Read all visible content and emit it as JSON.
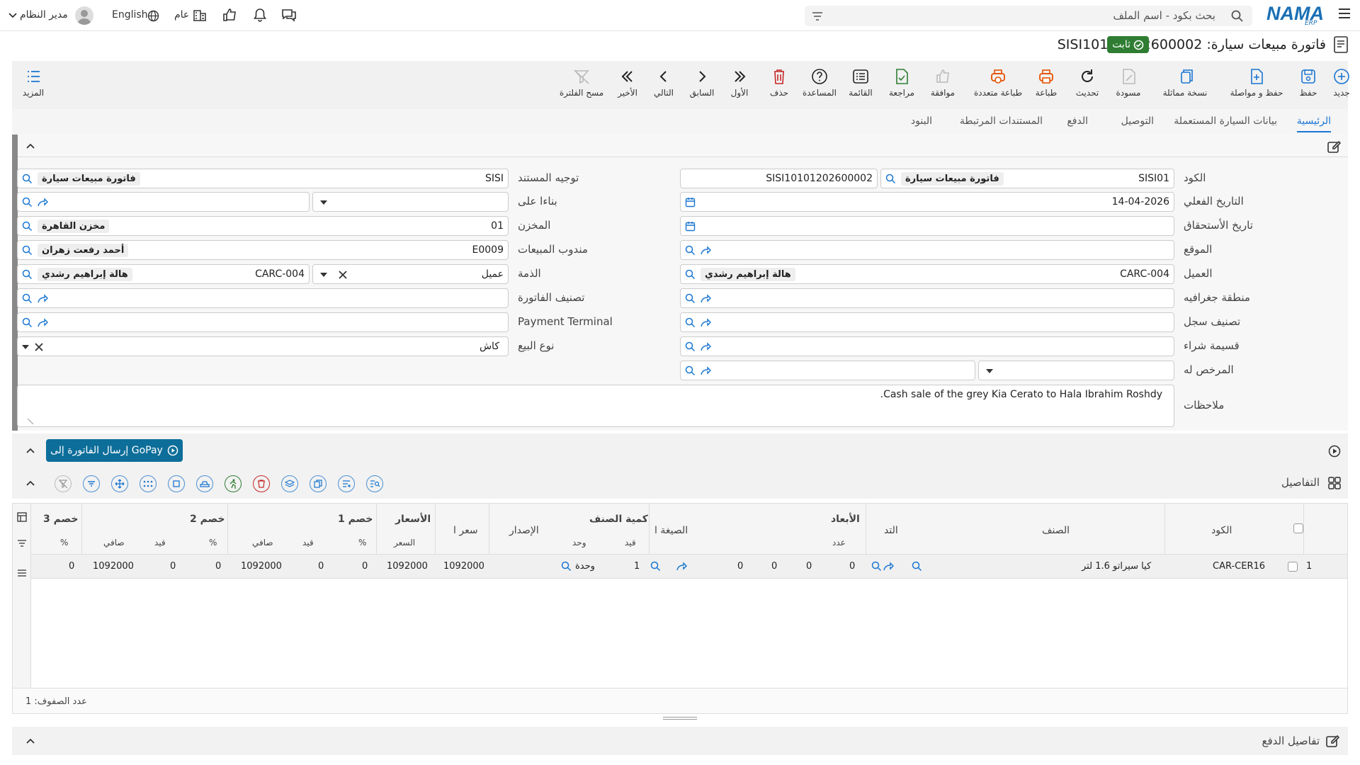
{
  "topbar": {
    "logo": "NAMA",
    "logo_sub": "ERP",
    "search_placeholder": "بحث بكود - اسم الملف",
    "user": "مدير النظام",
    "language": "English",
    "scope": "عام"
  },
  "title": {
    "text": "فاتورة مبيعات سيارة: SISI10101202600002",
    "status": "ثابت"
  },
  "toolbar": {
    "new": "جديد",
    "save": "حفظ",
    "save_continue": "حفظ و مواصلة",
    "duplicate": "نسخة مماثلة",
    "draft": "مسودة",
    "refresh": "تحديث",
    "print": "طباعة",
    "multi_print": "طباعة متعددة",
    "approve": "موافقة",
    "review": "مراجعة",
    "list": "القائمة",
    "help": "المساعدة",
    "delete": "حذف",
    "first": "الأول",
    "previous": "السابق",
    "next": "التالي",
    "last": "الأخير",
    "clear_filter": "مسح الفلترة",
    "more": "المزيد"
  },
  "tabs": [
    "الرئيسية",
    "بيانات السيارة المستعملة",
    "التوصيل",
    "الدفع",
    "المستندات المرتبطة",
    "البنود"
  ],
  "form": {
    "code_label": "الكود",
    "code_value": "SISI01",
    "code_chip": "فاتورة مبيعات سيارة",
    "code_serial": "SISI10101202600002",
    "actual_date_label": "التاريخ الفعلي",
    "actual_date": "14-04-2026",
    "due_date_label": "تاريخ الأستحقاق",
    "site_label": "الموقع",
    "customer_label": "العميل",
    "customer_code": "CARC-004",
    "customer_name": "هالة إبراهيم رشدي",
    "region_label": "منطقة جغرافيه",
    "record_class_label": "تصنيف سجل",
    "purchase_voucher_label": "قسيمة شراء",
    "licensee_label": "المرخص له",
    "notes_label": "ملاحظات",
    "notes": "Cash sale of the grey Kia Cerato to Hala Ibrahim Roshdy.",
    "doc_direction_label": "توجيه المستند",
    "doc_direction_value": "SISI",
    "doc_direction_chip": "فاتورة مبيعات سيارة",
    "based_on_label": "بناءا على",
    "warehouse_label": "المخزن",
    "warehouse_code": "01",
    "warehouse_name": "مخزن القاهرة",
    "salesman_label": "مندوب المبيعات",
    "salesman_code": "E0009",
    "salesman_name": "أحمد رفعت زهران",
    "liability_label": "الذمة",
    "liability_type": "عميل",
    "liability_code": "CARC-004",
    "liability_name": "هالة إبراهيم رشدي",
    "invoice_class_label": "تصنيف الفاتورة",
    "payment_terminal_label": "Payment Terminal",
    "sale_type_label": "نوع البيع",
    "sale_type": "كاش"
  },
  "gopay": "إرسال الفاتورة إلى GoPay",
  "details": {
    "title": "التفاصيل",
    "group_headers": [
      "الأبعاد",
      "كمية الصنف",
      "الأسعار",
      "خصم 1",
      "خصم 2",
      "خصم 3"
    ],
    "columns": [
      "الكود",
      "الصنف",
      "التد",
      "عدد",
      "الصيغة ا",
      "قيد",
      "وحد",
      "الإصدار",
      "سعر ا",
      "السعر",
      "%",
      "قيد",
      "صافي",
      "%",
      "قيد",
      "صافي",
      "%"
    ],
    "row": {
      "num": "1",
      "code": "CAR-CER16",
      "item": "كيا سيراتو 1.6 لتر",
      "d1": "0",
      "d2": "0",
      "d3": "0",
      "d4": "0",
      "qty": "1",
      "unit": "وحدة",
      "unit_price": "1092000",
      "price": "1092000",
      "disc1_pct": "0",
      "disc1_val": "0",
      "disc1_net": "1092000",
      "disc2_pct": "0",
      "disc2_val": "0",
      "disc2_net": "1092000",
      "disc3_pct": "0"
    },
    "row_count": "عدد الصفوف: 1"
  },
  "payment_details": "تفاصيل الدفع"
}
